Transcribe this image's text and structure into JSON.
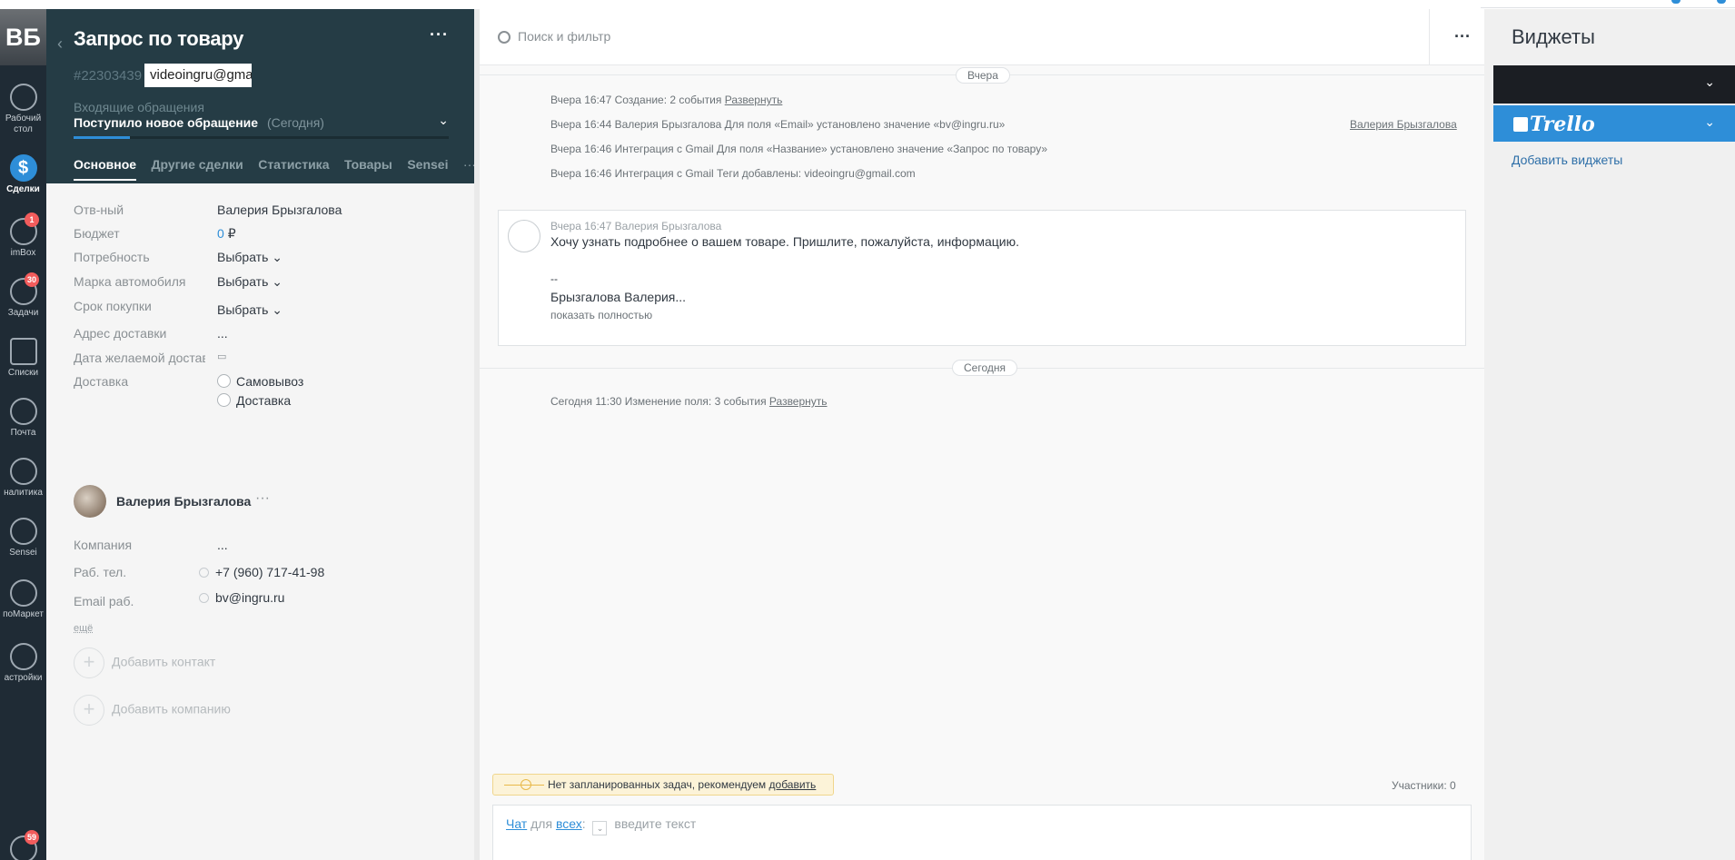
{
  "nav": {
    "avatar_initials": "ВБ",
    "items": [
      {
        "label": "Рабочий стол",
        "icon": "dashboard-icon"
      },
      {
        "label": "Сделки",
        "icon": "deals-icon",
        "active": true
      },
      {
        "label": "imBox",
        "icon": "chat-icon",
        "badge": "1"
      },
      {
        "label": "Задачи",
        "icon": "tasks-icon",
        "badge": "30"
      },
      {
        "label": "Списки",
        "icon": "lists-icon"
      },
      {
        "label": "Почта",
        "icon": "mail-icon"
      },
      {
        "label": "налитика",
        "icon": "analytics-icon"
      },
      {
        "label": "Sensei",
        "icon": "sensei-icon"
      },
      {
        "label": "поМаркет",
        "icon": "market-icon"
      },
      {
        "label": "астройки",
        "icon": "settings-icon"
      },
      {
        "label": "",
        "icon": "notifications-icon",
        "badge": "59"
      }
    ]
  },
  "lead": {
    "title": "Запрос по товару",
    "id": "#22303439",
    "tag": "videoingru@gmail.com",
    "pipeline": "Входящие обращения",
    "stage": "Поступило новое обращение",
    "stage_date": "(Сегодня)",
    "stage_progress": 0.15,
    "tabs": [
      "Основное",
      "Другие сделки",
      "Статистика",
      "Товары",
      "Sensei"
    ],
    "fields": [
      {
        "label": "Отв-ный",
        "value": "Валерия Брызгалова"
      },
      {
        "label": "Бюджет",
        "value": "0",
        "suffix": "₽"
      },
      {
        "label": "Потребность",
        "value": "Выбрать"
      },
      {
        "label": "Марка автомобиля",
        "value": "Выбрать"
      },
      {
        "label": "Срок покупки",
        "value": "Выбрать"
      },
      {
        "label": "Адрес доставки",
        "value": "..."
      },
      {
        "label": "Дата желаемой доставки",
        "value": ""
      },
      {
        "label": "Доставка",
        "options": [
          "Самовывоз",
          "Доставка"
        ]
      }
    ],
    "contact": {
      "name": "Валерия Брызгалова",
      "company_label": "Компания",
      "company_value": "...",
      "phone_label": "Раб. тел.",
      "phone": "+7 (960) 717-41-98",
      "email_label": "Email раб.",
      "email": "bv@ingru.ru",
      "more": "ещё"
    },
    "add_contact": "Добавить контакт",
    "add_company": "Добавить компанию"
  },
  "feed": {
    "search_placeholder": "Поиск и фильтр",
    "day_yesterday": "Вчера",
    "day_today": "Сегодня",
    "events_yesterday": [
      {
        "text": "Вчера 16:47 Создание: 2 события",
        "link": "Развернуть"
      },
      {
        "text": "Вчера 16:44 Валерия Брызгалова Для поля «Email» установлено значение «bv@ingru.ru»",
        "right": "Валерия Брызгалова"
      },
      {
        "text": "Вчера 16:46 Интеграция с Gmail Для поля «Название» установлено значение «Запрос по товару»"
      },
      {
        "text": "Вчера 16:46 Интеграция с Gmail Теги добавлены: videoingru@gmail.com"
      }
    ],
    "note": {
      "head": "Вчера 16:47 Валерия Брызгалова",
      "text": "Хочу узнать подробнее о вашем товаре. Пришлите, пожалуйста, информацию.",
      "dash": "--",
      "signature": "Брызгалова Валерия...",
      "show_full": "показать полностью"
    },
    "event_today": {
      "text": "Сегодня 11:30 Изменение поля: 3 события",
      "link": "Развернуть"
    },
    "task_bar": {
      "text": "Нет запланированных задач, рекомендуем",
      "link": "добавить"
    },
    "participants": "Участники: 0",
    "composer": {
      "chat": "Чат",
      "for": "для",
      "all": "всех",
      "placeholder": "введите текст"
    }
  },
  "widgets": {
    "title": "Виджеты",
    "trello": "Trello",
    "add": "Добавить виджеты"
  },
  "colors": {
    "accent": "#2e8ed8",
    "header_bg": "#253c45",
    "nav_bg": "#1f2b35",
    "badge": "#f25c5c"
  }
}
